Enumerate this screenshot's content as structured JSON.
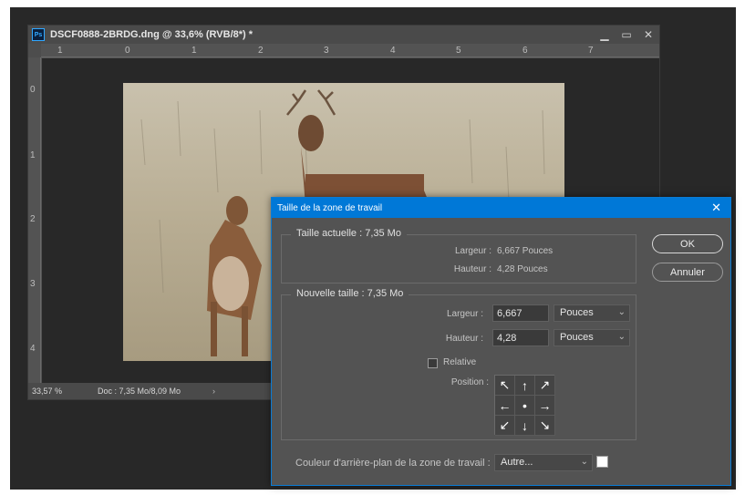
{
  "document": {
    "title": "DSCF0888-2BRDG.dng @ 33,6% (RVB/8*) *",
    "app_icon": "Ps",
    "window_controls": [
      "minimize-icon",
      "restore-icon",
      "close-icon"
    ],
    "ruler_h": [
      "1",
      "0",
      "1",
      "2",
      "3",
      "4",
      "5",
      "6",
      "7"
    ],
    "ruler_v": [
      "0",
      "1",
      "2",
      "3",
      "4"
    ],
    "zoom": "33,57 %",
    "doc_info": "Doc : 7,35 Mo/8,09 Mo",
    "status_arrow": "›"
  },
  "dialog": {
    "title": "Taille de la zone de travail",
    "close": "✕",
    "current": {
      "legend": "Taille actuelle : 7,35 Mo",
      "width_label": "Largeur :",
      "width_value": "6,667 Pouces",
      "height_label": "Hauteur :",
      "height_value": "4,28 Pouces"
    },
    "new": {
      "legend": "Nouvelle taille : 7,35 Mo",
      "width_label": "Largeur :",
      "width_value": "6,667",
      "width_unit": "Pouces",
      "height_label": "Hauteur :",
      "height_value": "4,28",
      "height_unit": "Pouces",
      "relative_label": "Relative",
      "relative_checked": false,
      "position_label": "Position :",
      "anchor_arrows": [
        "↖",
        "↑",
        "↗",
        "←",
        "•",
        "→",
        "↙",
        "↓",
        "↘"
      ]
    },
    "bg_color_label": "Couleur d'arrière-plan de la zone de travail :",
    "bg_color_value": "Autre...",
    "bg_color_swatch": "#ffffff",
    "ok_label": "OK",
    "cancel_label": "Annuler"
  },
  "colors": {
    "accent": "#0078d7",
    "panel": "#535353",
    "workspace": "#282828"
  }
}
